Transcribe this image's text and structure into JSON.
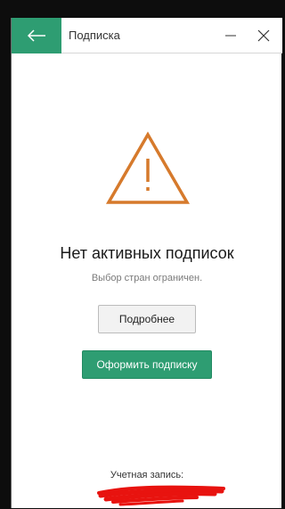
{
  "window": {
    "title": "Подписка",
    "accent_color": "#2e9d72"
  },
  "titlebar": {
    "back_icon": "arrow-left-icon",
    "minimize_icon": "minimize-icon",
    "close_icon": "close-icon"
  },
  "status": {
    "icon": "warning-triangle-icon",
    "icon_color": "#d67a2c",
    "heading": "Нет активных подписок",
    "subtext": "Выбор стран ограничен."
  },
  "actions": {
    "more_label": "Подробнее",
    "subscribe_label": "Оформить подписку"
  },
  "account": {
    "label": "Учетная запись:",
    "redaction_color": "#e8130f"
  }
}
